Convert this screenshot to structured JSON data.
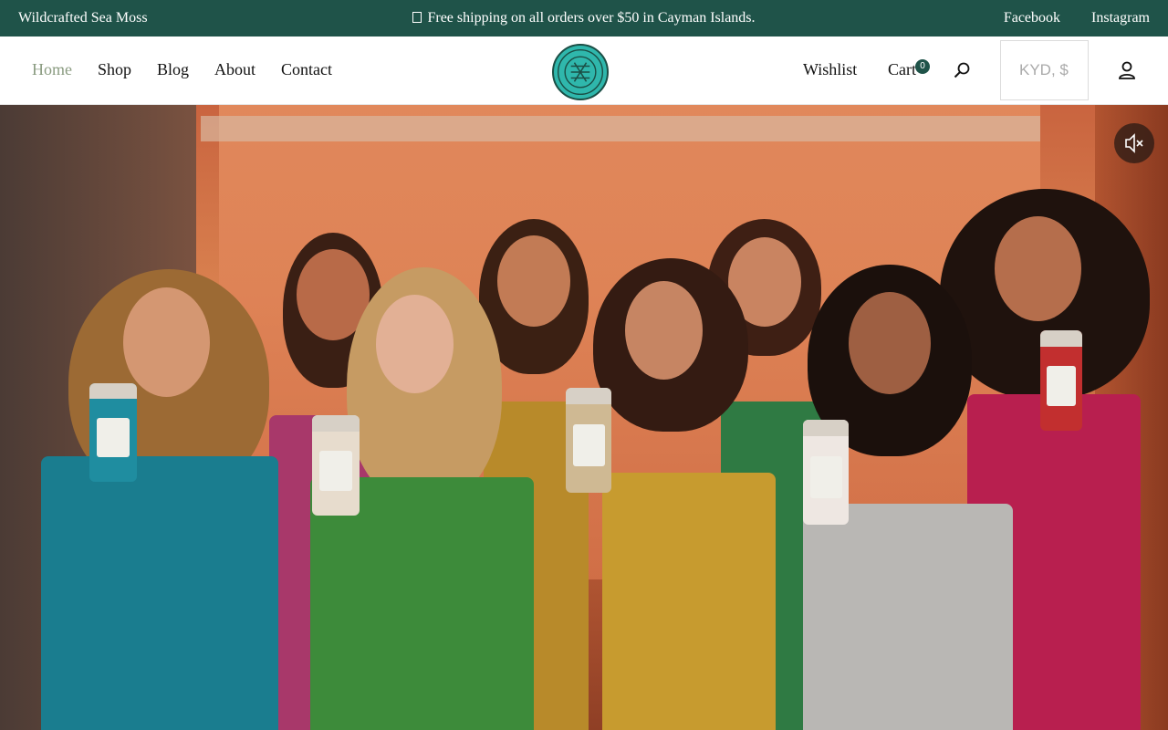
{
  "announcement": {
    "brand": "Wildcrafted Sea Moss",
    "message": "Free shipping on all orders over $50 in Cayman Islands.",
    "social": [
      "Facebook",
      "Instagram"
    ]
  },
  "nav": {
    "items": [
      "Home",
      "Shop",
      "Blog",
      "About",
      "Contact"
    ],
    "active": "Home"
  },
  "logo": {
    "alt_text": "THREE POLEPINE ORGANICS"
  },
  "header_right": {
    "wishlist": "Wishlist",
    "cart": "Cart",
    "cart_count": "0",
    "currency": "KYD, $"
  },
  "hero": {
    "mute_state": "muted"
  },
  "colors": {
    "brand_green": "#1f5349",
    "logo_teal": "#2fb7ac",
    "nav_active": "#8a9b80"
  },
  "icons": {
    "search": "search-icon",
    "account": "user-icon",
    "mute": "speaker-muted-icon"
  }
}
